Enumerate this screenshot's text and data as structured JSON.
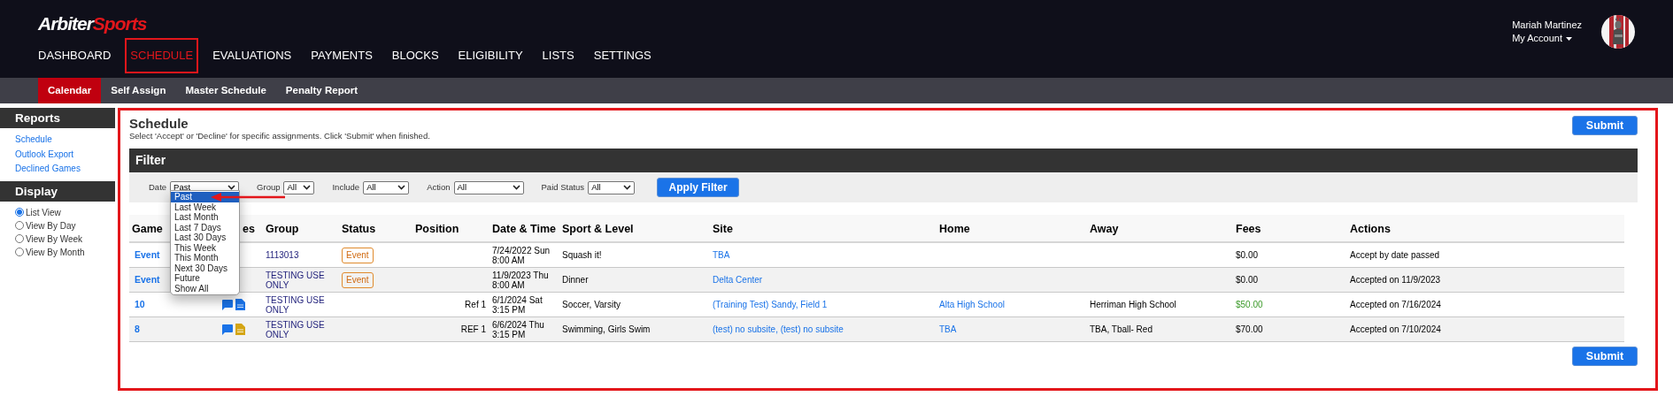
{
  "brand": {
    "left": "Arbiter",
    "right": "Sports"
  },
  "nav": [
    {
      "label": "DASHBOARD",
      "selected": false
    },
    {
      "label": "SCHEDULE",
      "selected": true
    },
    {
      "label": "EVALUATIONS",
      "selected": false
    },
    {
      "label": "PAYMENTS",
      "selected": false
    },
    {
      "label": "BLOCKS",
      "selected": false
    },
    {
      "label": "ELIGIBILITY",
      "selected": false
    },
    {
      "label": "LISTS",
      "selected": false
    },
    {
      "label": "SETTINGS",
      "selected": false
    }
  ],
  "user": {
    "name": "Mariah Martinez",
    "account": "My Account"
  },
  "subnav": [
    {
      "label": "Calendar",
      "selected": true
    },
    {
      "label": "Self Assign",
      "selected": false
    },
    {
      "label": "Master Schedule",
      "selected": false
    },
    {
      "label": "Penalty Report",
      "selected": false
    }
  ],
  "sidebar": [
    {
      "title": "Reports",
      "kind": "links",
      "items": [
        {
          "label": "Schedule"
        },
        {
          "label": "Outlook Export"
        },
        {
          "label": "Declined Games"
        }
      ]
    },
    {
      "title": "Display",
      "kind": "radios",
      "items": [
        {
          "label": "List View",
          "selected": true
        },
        {
          "label": "View By Day",
          "selected": false
        },
        {
          "label": "View By Week",
          "selected": false
        },
        {
          "label": "View By Month",
          "selected": false
        }
      ]
    }
  ],
  "page": {
    "title": "Schedule",
    "instructions": "Select 'Accept' or 'Decline' for specific assignments. Click 'Submit' when finished.",
    "submit_top": "Submit",
    "submit_bottom": "Submit"
  },
  "filter": {
    "title": "Filter",
    "fields": [
      {
        "label": "Date",
        "value": "Past"
      },
      {
        "label": "Group",
        "value": "All"
      },
      {
        "label": "Include",
        "value": "All"
      },
      {
        "label": "Action",
        "value": "All"
      },
      {
        "label": "Paid Status",
        "value": "All"
      }
    ],
    "apply": "Apply Filter"
  },
  "date_dropdown": {
    "options": [
      {
        "label": "Past",
        "selected": true
      },
      {
        "label": "Last Week",
        "selected": false
      },
      {
        "label": "Last Month",
        "selected": false
      },
      {
        "label": "Last 7 Days",
        "selected": false
      },
      {
        "label": "Last 30 Days",
        "selected": false
      },
      {
        "label": "This Week",
        "selected": false
      },
      {
        "label": "This Month",
        "selected": false
      },
      {
        "label": "Next 30 Days",
        "selected": false
      },
      {
        "label": "Future",
        "selected": false
      },
      {
        "label": "Show All",
        "selected": false
      }
    ]
  },
  "table": {
    "columns": [
      "Game",
      "es",
      "Group",
      "Status",
      "Position",
      "Date & Time",
      "Sport & Level",
      "Site",
      "Home",
      "Away",
      "Fees",
      "Actions"
    ],
    "rows": [
      {
        "game": "Event",
        "group": "1113013",
        "status": "Event",
        "date_time": "7/24/2022 Sun 8:00 AM",
        "sport_level": "Squash it!",
        "site": "TBA",
        "fees": "$0.00",
        "fee_paid": false,
        "actions": "Accept by date passed"
      },
      {
        "game": "Event",
        "group": "TESTING USE ONLY",
        "status": "Event",
        "date_time": "11/9/2023 Thu 8:00 AM",
        "sport_level": "Dinner",
        "site": "Delta Center",
        "fees": "$0.00",
        "fee_paid": false,
        "actions": "Accepted on 11/9/2023"
      },
      {
        "game": "10",
        "notes": [
          {
            "kind": "chat",
            "color": "#1a73e8"
          },
          {
            "kind": "document",
            "color": "#1a73e8"
          }
        ],
        "group": "TESTING USE ONLY",
        "position": "Ref 1",
        "date_time": "6/1/2024 Sat 3:15 PM",
        "sport_level": "Soccer, Varsity",
        "site": "(Training Test) Sandy, Field 1",
        "home": "Alta High School",
        "away": "Herriman High School",
        "fees": "$50.00",
        "fee_paid": true,
        "actions": "Accepted on 7/16/2024"
      },
      {
        "game": "8",
        "notes": [
          {
            "kind": "chat",
            "color": "#1a73e8"
          },
          {
            "kind": "document",
            "color": "#d4a514"
          }
        ],
        "group": "TESTING USE ONLY",
        "position": "REF 1",
        "date_time": "6/6/2024 Thu 3:15 PM",
        "sport_level": "Swimming, Girls Swim",
        "site": "(test) no subsite, (test) no subsite",
        "home": "TBA",
        "away": "TBA, Tball- Red",
        "fees": "$70.00",
        "fee_paid": false,
        "actions": "Accepted on 7/10/2024"
      }
    ]
  }
}
